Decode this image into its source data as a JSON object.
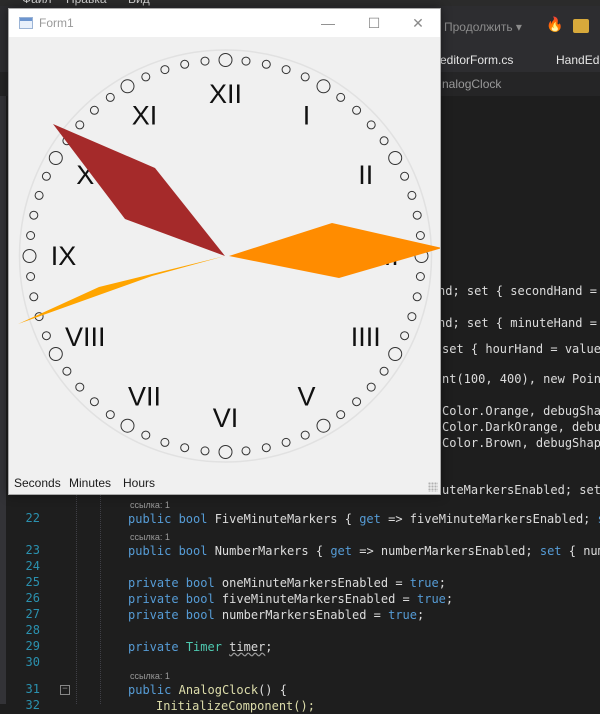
{
  "ide": {
    "toolbar": {
      "continue_label": "Продолжить ▾"
    },
    "tabs": [
      "editorForm.cs",
      "HandEd"
    ],
    "nav": {
      "member": "nalogClock"
    },
    "code": {
      "code_r1": "nd; set { secondHand = ",
      "code_r2": "nd; set { minuteHand = ",
      "code_r3": "set { hourHand = value;",
      "code_r4": "nt(100, 400), new Point",
      "code_r5": "Color.Orange, debugShape",
      "code_r6": "Color.DarkOrange, debug",
      "code_r7": "Color.Brown, debugShape);",
      "code_r8": "uteMarkersEnabled; set {",
      "lens1": "ссылка: 1",
      "lens2": "ссылка: 1",
      "lens3": "ссылка: 1",
      "ln22": "22",
      "ln23": "23",
      "ln24": "24",
      "ln25": "25",
      "ln26": "26",
      "ln27": "27",
      "ln28": "28",
      "ln29": "29",
      "ln30": "30",
      "ln31": "31",
      "ln32": "32",
      "l22_a": "public bool",
      "l22_b": " FiveMinuteMarkers { ",
      "l22_c": "get",
      "l22_d": " => fiveMinuteMarkersEnabled; ",
      "l22_e": "set",
      "l23_a": "public bool",
      "l23_b": " NumberMarkers { ",
      "l23_c": "get",
      "l23_d": " => numberMarkersEnabled; ",
      "l23_e": "set",
      "l23_f": " { number",
      "l25_a": "private bool",
      "l25_b": " oneMinuteMarkersEnabled = ",
      "l25_c": "true",
      "l25_d": ";",
      "l26_a": "private bool",
      "l26_b": " fiveMinuteMarkersEnabled = ",
      "l26_c": "true",
      "l26_d": ";",
      "l27_a": "private bool",
      "l27_b": " numberMarkersEnabled = ",
      "l27_c": "true",
      "l27_d": ";",
      "l29_a": "private",
      "l29_b": "Timer",
      "l29_c": "timer",
      "l29_d": ";",
      "l31_a": "public",
      "l31_b": "AnalogClock",
      "l31_c": "() {",
      "l32_a": "InitializeComponent();"
    }
  },
  "form": {
    "title": "Form1",
    "buttons": {
      "minimize": "—",
      "maximize": "☐",
      "close": "✕"
    },
    "status": {
      "seconds": "Seconds",
      "minutes": "Minutes",
      "hours": "Hours"
    }
  },
  "clock": {
    "numerals": [
      "XII",
      "I",
      "II",
      "III",
      "IIII",
      "V",
      "VI",
      "VII",
      "VIII",
      "IX",
      "X",
      "XI"
    ],
    "hands": {
      "hour": {
        "color": "#a52a2a",
        "name": "Brown"
      },
      "minute": {
        "color": "#ff8c00",
        "name": "DarkOrange"
      },
      "second": {
        "color": "#ffa500",
        "name": "Orange"
      }
    },
    "marker_color": "#333333",
    "face_color": "#f0f0f0"
  }
}
